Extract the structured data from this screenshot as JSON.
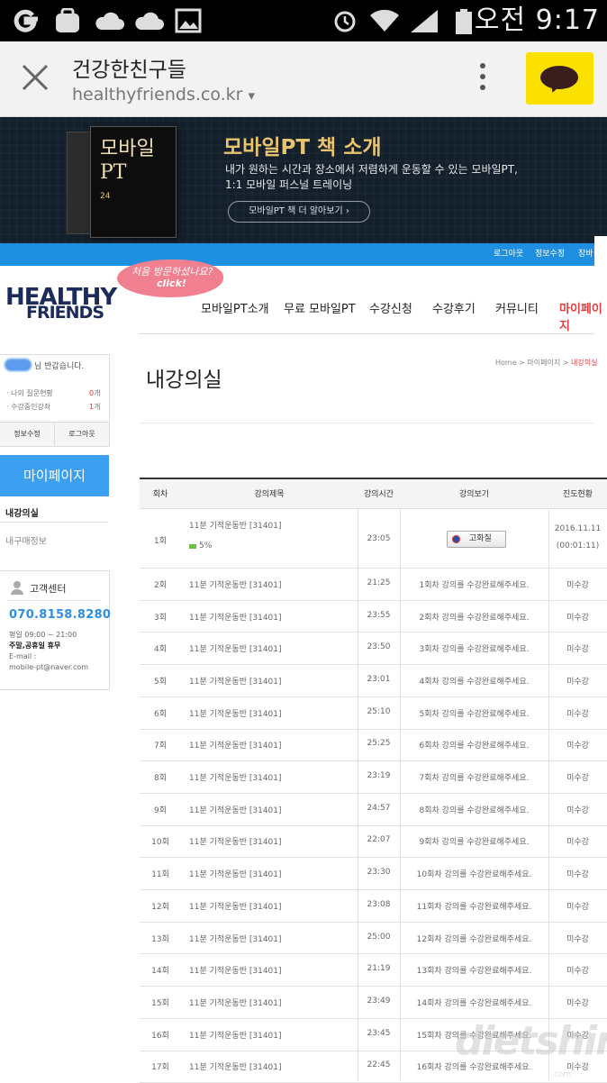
{
  "status_bar": {
    "time": "오전 9:17",
    "icons": [
      "g-app-icon",
      "galaxy-bag-icon",
      "cloud-icon",
      "cloud-icon",
      "image-icon",
      "alarm-icon",
      "wifi-icon",
      "signal-icon",
      "battery-icon"
    ]
  },
  "browser": {
    "title": "건강한친구들",
    "url": "healthyfriends.co.kr",
    "url_dropdown": "▾"
  },
  "banner": {
    "book_title_1": "모바일",
    "book_title_2": "PT",
    "book_sub": "24",
    "title": "모바일PT 책 소개",
    "desc_1": "내가 원하는 시간과 장소에서 저렴하게 운동할 수 있는 모바일PT,",
    "desc_2": "1:1 모바일 퍼스널 트레이닝",
    "button": "모바일PT 책 더 알아보기  ›"
  },
  "top_links": [
    "로그아웃",
    "정보수정",
    "장바구"
  ],
  "logo": {
    "line1": "HEALTHY",
    "line2": "FRIENDS"
  },
  "bubble": {
    "line1": "처음 방문하셨나요?",
    "line2": "click!"
  },
  "gnb": [
    "모바일PT소개",
    "무료 모바일PT",
    "수강신청",
    "수강후기",
    "커뮤니티",
    "마이페이지"
  ],
  "accent_colors": {
    "blue": "#1e8fe1",
    "nav_active": "#e04040",
    "mypage": "#3d9ff0"
  },
  "user_box": {
    "welcome": "님 반갑습니다.",
    "stats": [
      {
        "label": "· 나의 질문현황",
        "value": "0",
        "unit": "개"
      },
      {
        "label": "· 수강중인강좌",
        "value": "1",
        "unit": "개"
      }
    ],
    "buttons": [
      "정보수정",
      "로그아웃"
    ]
  },
  "sidebar": {
    "heading": "마이페이지",
    "items": [
      "내강의실",
      "내구매정보"
    ]
  },
  "customer_center": {
    "title": "고객센터",
    "phone": "070.8158.8280",
    "hours": "평일 09:00 ~ 21:00",
    "closed": "주말,공휴일 휴무",
    "email_label": "E-mail :",
    "email": "mobile-pt@naver.com"
  },
  "page": {
    "title": "내강의실",
    "breadcrumb": [
      "Home",
      "마이페이지",
      "내강의실"
    ],
    "breadcrumb_sep": ">"
  },
  "table": {
    "headers": [
      "회차",
      "강의제목",
      "강의시간",
      "강의보기",
      "진도현황"
    ],
    "first_row": {
      "no": "1회",
      "title": "11분 기적운동반 [31401]",
      "progress_label": "5%",
      "progress": 0.05,
      "time": "23:05",
      "button": "고화질",
      "date": "2016.11.11",
      "duration": "(00:01:11)"
    },
    "rows": [
      {
        "no": "2회",
        "title": "11분 기적운동반 [31401]",
        "time": "21:25",
        "view": "1회차 강의를 수강완료해주세요.",
        "status": "미수강"
      },
      {
        "no": "3회",
        "title": "11분 기적운동반 [31401]",
        "time": "23:55",
        "view": "2회차 강의를 수강완료해주세요.",
        "status": "미수강"
      },
      {
        "no": "4회",
        "title": "11분 기적운동반 [31401]",
        "time": "23:50",
        "view": "3회차 강의를 수강완료해주세요.",
        "status": "미수강"
      },
      {
        "no": "5회",
        "title": "11분 기적운동반 [31401]",
        "time": "23:01",
        "view": "4회차 강의를 수강완료해주세요.",
        "status": "미수강"
      },
      {
        "no": "6회",
        "title": "11분 기적운동반 [31401]",
        "time": "25:10",
        "view": "5회차 강의를 수강완료해주세요.",
        "status": "미수강"
      },
      {
        "no": "7회",
        "title": "11분 기적운동반 [31401]",
        "time": "25:25",
        "view": "6회차 강의를 수강완료해주세요.",
        "status": "미수강"
      },
      {
        "no": "8회",
        "title": "11분 기적운동반 [31401]",
        "time": "23:19",
        "view": "7회차 강의를 수강완료해주세요.",
        "status": "미수강"
      },
      {
        "no": "9회",
        "title": "11분 기적운동반 [31401]",
        "time": "24:57",
        "view": "8회차 강의를 수강완료해주세요.",
        "status": "미수강"
      },
      {
        "no": "10회",
        "title": "11분 기적운동반 [31401]",
        "time": "22:07",
        "view": "9회차 강의를 수강완료해주세요.",
        "status": "미수강"
      },
      {
        "no": "11회",
        "title": "11분 기적운동반 [31401]",
        "time": "23:30",
        "view": "10회차 강의를 수강완료해주세요.",
        "status": "미수강"
      },
      {
        "no": "12회",
        "title": "11분 기적운동반 [31401]",
        "time": "23:08",
        "view": "11회차 강의를 수강완료해주세요.",
        "status": "미수강"
      },
      {
        "no": "13회",
        "title": "11분 기적운동반 [31401]",
        "time": "25:00",
        "view": "12회차 강의를 수강완료해주세요.",
        "status": "미수강"
      },
      {
        "no": "14회",
        "title": "11분 기적운동반 [31401]",
        "time": "21:19",
        "view": "13회차 강의를 수강완료해주세요.",
        "status": "미수강"
      },
      {
        "no": "15회",
        "title": "11분 기적운동반 [31401]",
        "time": "23:49",
        "view": "14회차 강의를 수강완료해주세요.",
        "status": "미수강"
      },
      {
        "no": "16회",
        "title": "11분 기적운동반 [31401]",
        "time": "23:45",
        "view": "15회차 강의를 수강완료해주세요.",
        "status": "미수강"
      },
      {
        "no": "17회",
        "title": "11분 기적운동반 [31401]",
        "time": "22:45",
        "view": "16회차 강의를 수강완료해주세요.",
        "status": "미수강"
      }
    ]
  },
  "watermark": {
    "text": "dietshin",
    "sub": ".com"
  }
}
